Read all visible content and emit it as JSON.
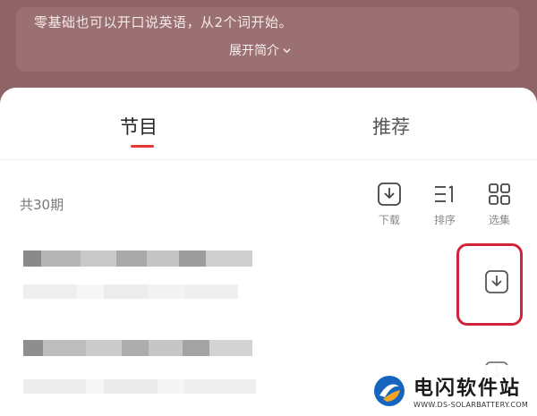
{
  "intro": {
    "text": "零基础也可以开口说英语，从2个词开始。",
    "expand_label": "展开简介"
  },
  "tabs": [
    {
      "label": "节目",
      "active": true
    },
    {
      "label": "推荐",
      "active": false
    }
  ],
  "list": {
    "episode_count": "共30期"
  },
  "toolbar": {
    "download_label": "下载",
    "sort_label": "排序",
    "select_label": "选集"
  },
  "watermark": {
    "title": "电闪软件站",
    "url": "WWW.DS-SOLARBATTERY.COM"
  },
  "colors": {
    "header_bg": "#8f6466",
    "accent_red": "#e53935",
    "highlight": "#d0243a"
  }
}
